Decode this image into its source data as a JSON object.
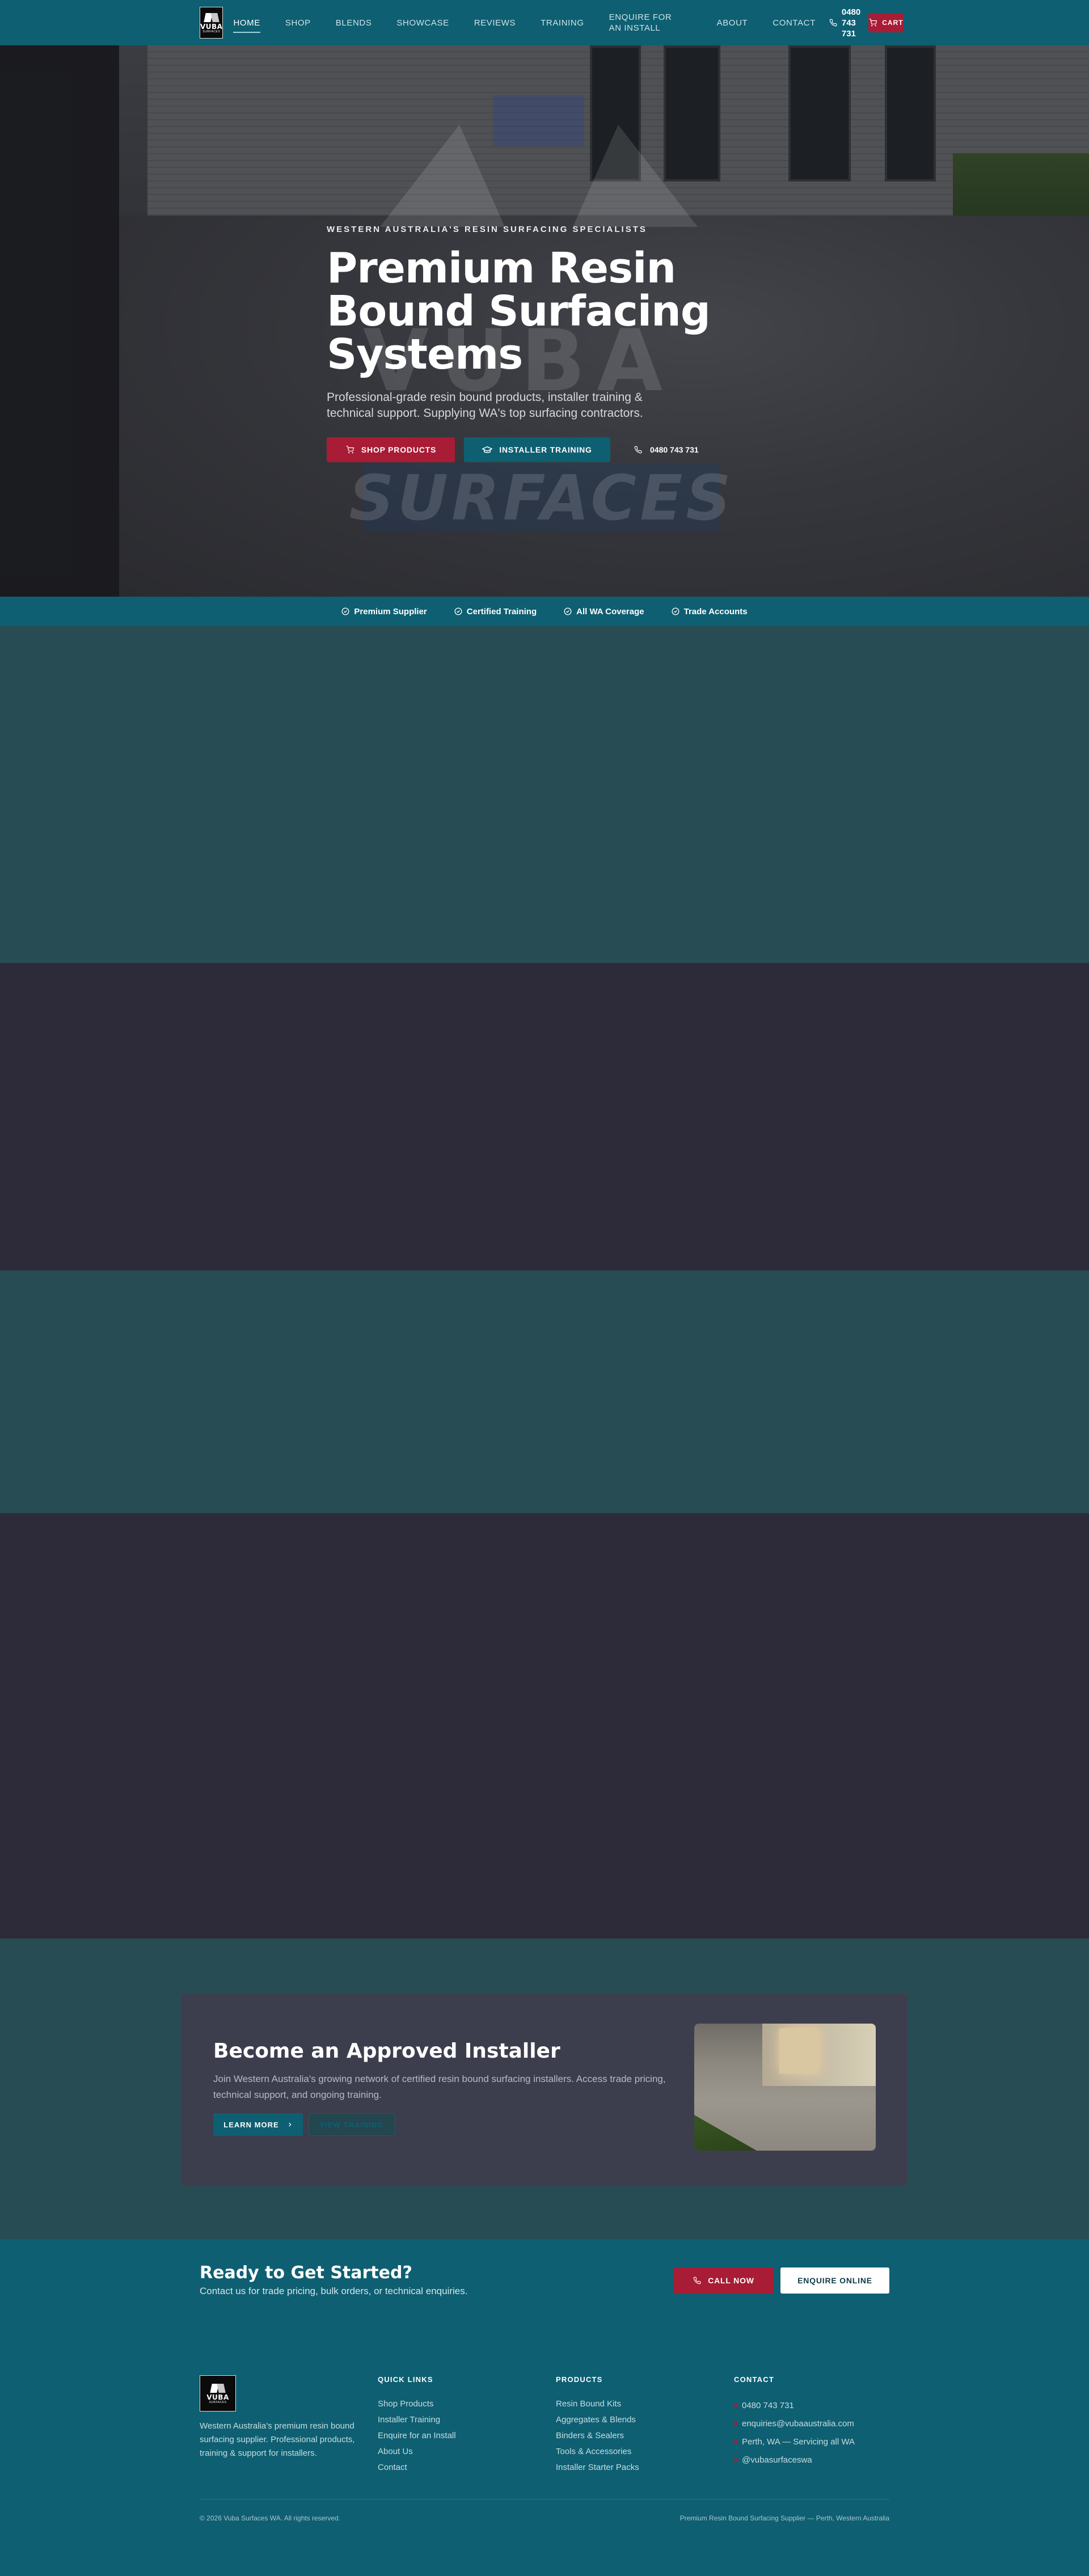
{
  "nav": {
    "logo_word": "VUBA",
    "logo_sub": "SURFACES",
    "items": [
      {
        "label": "HOME",
        "active": true
      },
      {
        "label": "SHOP"
      },
      {
        "label": "BLENDS"
      },
      {
        "label": "SHOWCASE"
      },
      {
        "label": "REVIEWS"
      },
      {
        "label": "TRAINING"
      },
      {
        "label": "ENQUIRE FOR AN INSTALL"
      },
      {
        "label": "ABOUT"
      },
      {
        "label": "CONTACT"
      }
    ],
    "phone": "0480 743 731",
    "cart_label": "CART"
  },
  "hero": {
    "eyebrow": "WESTERN AUSTRALIA'S RESIN SURFACING SPECIALISTS",
    "title": "Premium Resin Bound Surfacing Systems",
    "subtitle": "Professional-grade resin bound products, installer training & technical support. Supplying WA's top surfacing contractors.",
    "shop_button": "SHOP PRODUCTS",
    "training_button": "INSTALLER TRAINING",
    "phone": "0480 743 731",
    "watermark_word": "VUBA",
    "watermark_sub": "SURFACES"
  },
  "trust_bar": [
    "Premium Supplier",
    "Certified Training",
    "All WA Coverage",
    "Trade Accounts"
  ],
  "installer": {
    "title": "Become an Approved Installer",
    "text": "Join Western Australia's growing network of certified resin bound surfacing installers. Access trade pricing, technical support, and ongoing training.",
    "learn_button": "LEARN MORE",
    "view_button": "VIEW TRAINING"
  },
  "cta": {
    "title": "Ready to Get Started?",
    "subtitle": "Contact us for trade pricing, bulk orders, or technical enquiries.",
    "call_button": "CALL NOW",
    "enquire_button": "ENQUIRE ONLINE"
  },
  "footer": {
    "about": "Western Australia's premium resin bound surfacing supplier. Professional products, training & support for installers.",
    "quick_links": {
      "heading": "QUICK LINKS",
      "items": [
        "Shop Products",
        "Installer Training",
        "Enquire for an Install",
        "About Us",
        "Contact"
      ]
    },
    "products": {
      "heading": "PRODUCTS",
      "items": [
        "Resin Bound Kits",
        "Aggregates & Blends",
        "Binders & Sealers",
        "Tools & Accessories",
        "Installer Starter Packs"
      ]
    },
    "contact": {
      "heading": "CONTACT",
      "items": [
        "0480 743 731",
        "enquiries@vubaaustralia.com",
        "Perth, WA — Servicing all WA",
        "@vubasurfaceswa"
      ]
    },
    "copyright": "© 2026 Vuba Surfaces WA. All rights reserved.",
    "tagline": "Premium Resin Bound Surfacing Supplier — Perth, Western Australia"
  },
  "colors": {
    "brand_teal": "#0e5f72",
    "brand_red": "#a81c35",
    "band_teal": "#274c54",
    "band_dark": "#2d2b3a"
  }
}
